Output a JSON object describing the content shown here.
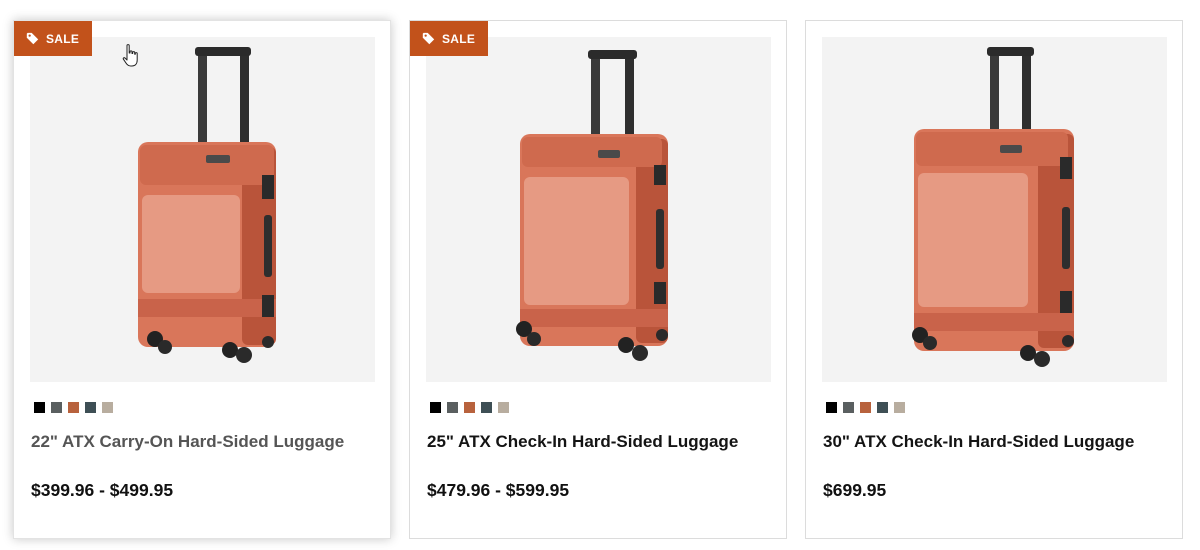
{
  "products": [
    {
      "sale_label": "SALE",
      "title": "22\" ATX Carry-On Hard-Sided Luggage",
      "price": "$399.96 - $499.95",
      "on_sale": true,
      "hovered": true,
      "swatches": [
        "#000000",
        "#5a5f60",
        "#b8623d",
        "#3e4f55",
        "#b8ad9f"
      ]
    },
    {
      "sale_label": "SALE",
      "title": "25\" ATX Check-In Hard-Sided Luggage",
      "price": "$479.96 - $599.95",
      "on_sale": true,
      "hovered": false,
      "swatches": [
        "#000000",
        "#5a5f60",
        "#b8623d",
        "#3e4f55",
        "#b8ad9f"
      ]
    },
    {
      "title": "30\" ATX Check-In Hard-Sided Luggage",
      "price": "$699.95",
      "on_sale": false,
      "hovered": false,
      "swatches": [
        "#000000",
        "#5a5f60",
        "#b8623d",
        "#3e4f55",
        "#b8ad9f"
      ]
    }
  ],
  "colors": {
    "sale_badge": "#c2521b",
    "luggage_shell": "#d9765a",
    "luggage_dark": "#b9543a"
  }
}
